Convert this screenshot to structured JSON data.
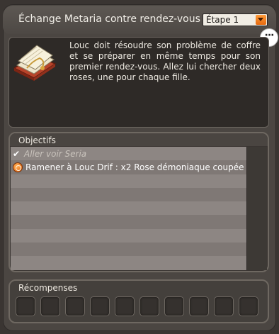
{
  "quest": {
    "title": "Échange Metaria contre rendez-vous",
    "step_label": "Étape 1",
    "description": "Louc doit résoudre son problème de coffre et se préparer en même temps pour son premier rendez-vous. Allez lui chercher deux roses, une pour chaque fille."
  },
  "chat_icon": "···",
  "objectives": {
    "header": "Objectifs",
    "items": [
      {
        "label": "Aller voir Seria",
        "status": "done",
        "icon": "check-icon"
      },
      {
        "label": "Ramener à Louc Drif : x2 Rose démoniaque coupée",
        "status": "active",
        "icon": "action-icon"
      }
    ],
    "empty_rows": 7
  },
  "rewards": {
    "header": "Récompenses",
    "slot_count": 10
  },
  "colors": {
    "accent_orange": "#e56a10",
    "panel_bg": "#4b4642",
    "row_light": "#8d8683",
    "row_dark": "#7f7875"
  }
}
